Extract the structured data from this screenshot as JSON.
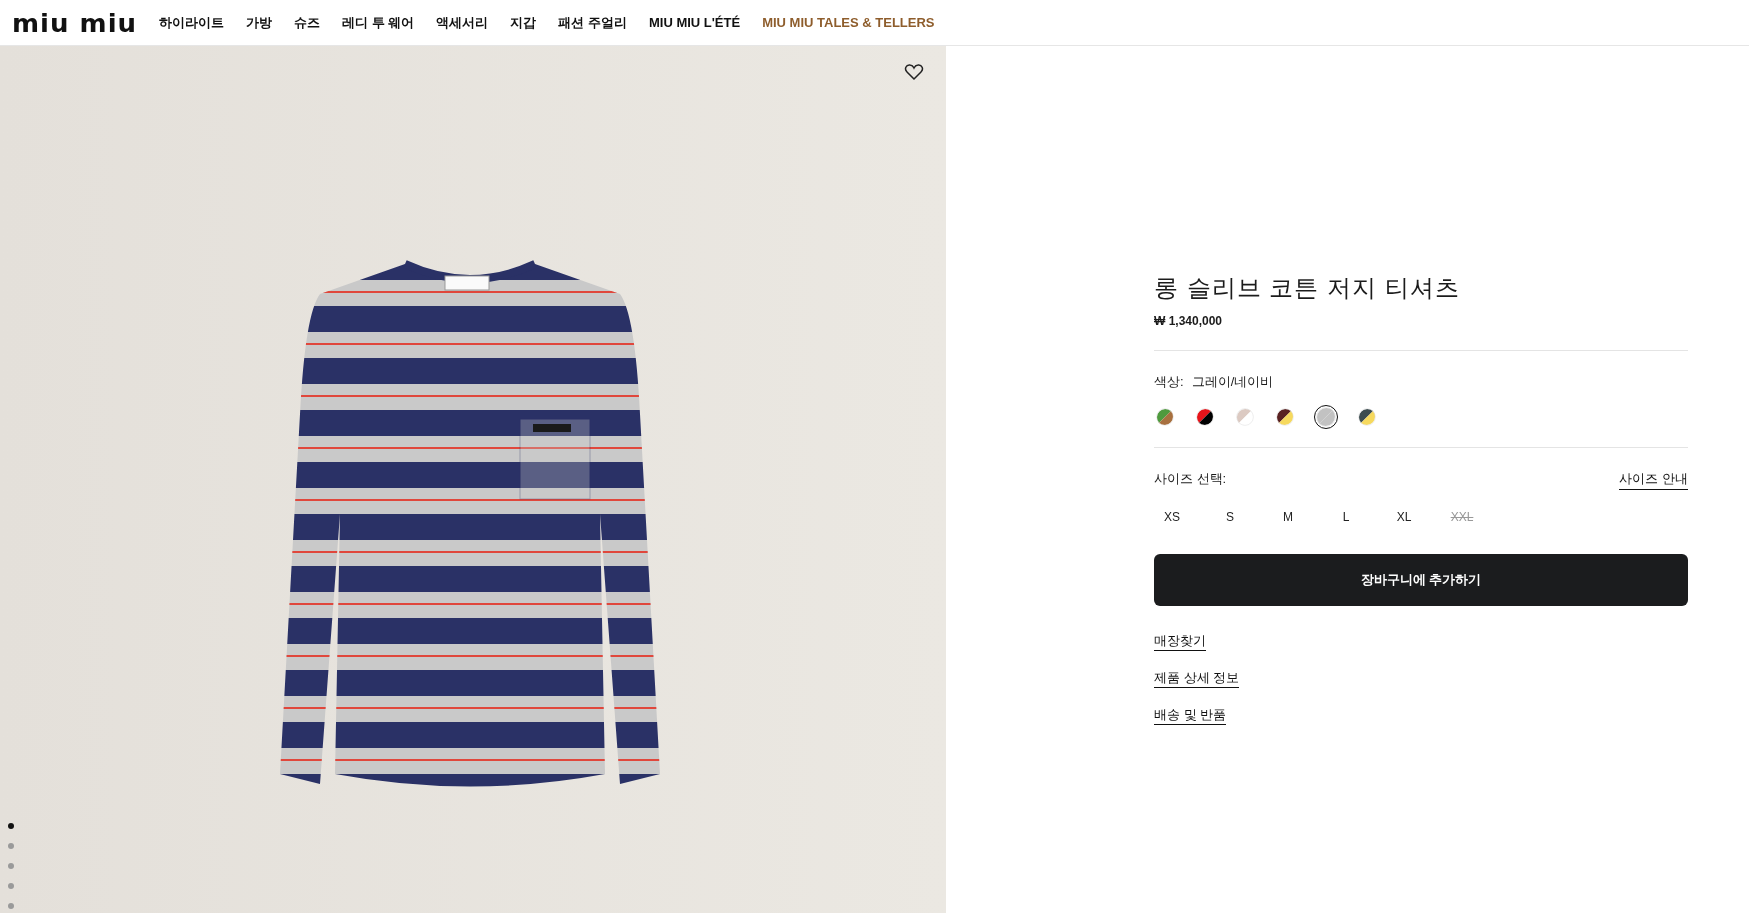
{
  "header": {
    "logo": "miu miu",
    "nav": [
      {
        "label": "하이라이트",
        "kind": "plain"
      },
      {
        "label": "가방",
        "kind": "plain"
      },
      {
        "label": "슈즈",
        "kind": "plain"
      },
      {
        "label": "레디 투 웨어",
        "kind": "plain"
      },
      {
        "label": "액세서리",
        "kind": "plain"
      },
      {
        "label": "지갑",
        "kind": "plain"
      },
      {
        "label": "패션 주얼리",
        "kind": "plain"
      },
      {
        "label": "MIU MIU L'ÉTÉ",
        "kind": "plain"
      },
      {
        "label": "MIU MIU TALES & TELLERS",
        "kind": "highlight"
      }
    ]
  },
  "gallery": {
    "dots": [
      {
        "selected": true
      },
      {
        "selected": false
      },
      {
        "selected": false
      },
      {
        "selected": false
      },
      {
        "selected": false
      }
    ]
  },
  "product": {
    "title": "롱 슬리브 코튼 저지 티셔츠",
    "price": "₩ 1,340,000",
    "color_label": "색상:",
    "color_value": "그레이/네이비",
    "swatches": [
      {
        "halves": [
          {
            "color": "#4f9a3e"
          },
          {
            "color": "#a8703f"
          }
        ],
        "selected": false
      },
      {
        "halves": [
          {
            "color": "#e8141a"
          },
          {
            "color": "#000000"
          }
        ],
        "selected": false
      },
      {
        "halves": [
          {
            "color": "#dccac2"
          },
          {
            "color": "#ffffff"
          }
        ],
        "selected": false
      },
      {
        "halves": [
          {
            "color": "#5a2222"
          },
          {
            "color": "#f6d95e"
          }
        ],
        "selected": false
      },
      {
        "halves": [
          {
            "color": "#c2c2c2"
          },
          {
            "color": "#c2c2c2"
          }
        ],
        "selected": true
      },
      {
        "halves": [
          {
            "color": "#3c4c50"
          },
          {
            "color": "#f6d95e"
          }
        ],
        "selected": false
      }
    ],
    "size_label": "사이즈 선택:",
    "size_guide": "사이즈 안내",
    "sizes": [
      {
        "label": "XS",
        "disabled": false
      },
      {
        "label": "S",
        "disabled": false
      },
      {
        "label": "M",
        "disabled": false
      },
      {
        "label": "L",
        "disabled": false
      },
      {
        "label": "XL",
        "disabled": false
      },
      {
        "label": "XXL",
        "disabled": true
      }
    ],
    "add_to_cart": "장바구니에 추가하기",
    "links": [
      "매장찾기",
      "제품 상세 정보",
      "배송 및 반품"
    ]
  }
}
